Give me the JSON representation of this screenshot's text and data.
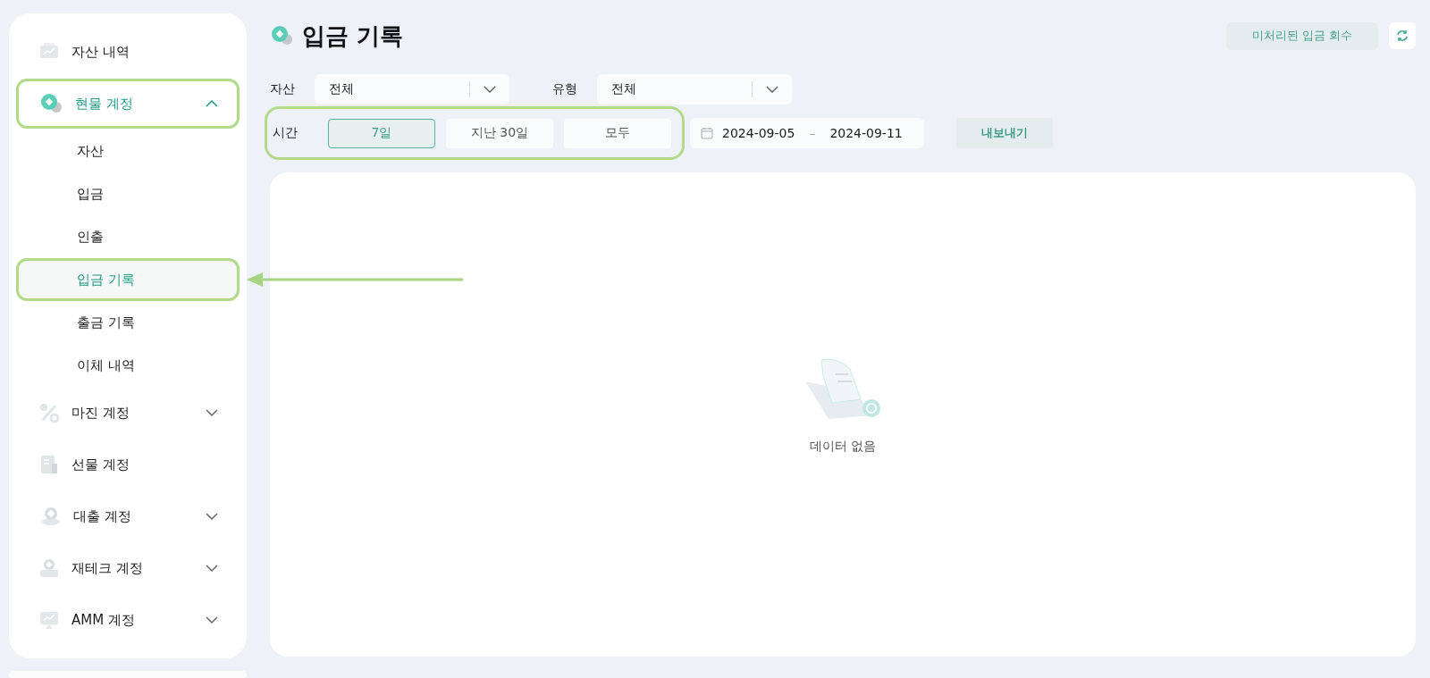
{
  "sidebar": {
    "items": [
      {
        "label": "자산 내역",
        "kind": "link",
        "selected": false,
        "highlighted": false
      },
      {
        "label": "현물 계정",
        "kind": "group",
        "selected": true,
        "expanded": true,
        "highlighted": true,
        "children": [
          {
            "label": "자산",
            "selected": false,
            "highlighted": false
          },
          {
            "label": "입금",
            "selected": false,
            "highlighted": false
          },
          {
            "label": "인출",
            "selected": false,
            "highlighted": false
          },
          {
            "label": "입금 기록",
            "selected": true,
            "highlighted": true,
            "pointer_arrow": true
          },
          {
            "label": "출금 기록",
            "selected": false,
            "highlighted": false
          },
          {
            "label": "이체 내역",
            "selected": false,
            "highlighted": false
          }
        ]
      },
      {
        "label": "마진 계정",
        "kind": "group",
        "selected": false,
        "expanded": false,
        "highlighted": false
      },
      {
        "label": "선물 계정",
        "kind": "link",
        "selected": false,
        "highlighted": false
      },
      {
        "label": "대출 계정",
        "kind": "group",
        "selected": false,
        "expanded": false,
        "highlighted": false
      },
      {
        "label": "재테크 계정",
        "kind": "group",
        "selected": false,
        "expanded": false,
        "highlighted": false
      },
      {
        "label": "AMM 계정",
        "kind": "group",
        "selected": false,
        "expanded": false,
        "highlighted": false
      }
    ]
  },
  "header": {
    "title": "입금 기록",
    "recover_button": "미처리된 입금 회수"
  },
  "filters": {
    "asset": {
      "label": "자산",
      "value": "전체"
    },
    "type": {
      "label": "유형",
      "value": "전체"
    },
    "time": {
      "label": "시간",
      "highlighted": true,
      "options": [
        {
          "label": "7일",
          "selected": true
        },
        {
          "label": "지난 30일",
          "selected": false
        },
        {
          "label": "모두",
          "selected": false
        }
      ]
    },
    "date_range": {
      "start": "2024-09-05",
      "separator": "–",
      "end": "2024-09-11"
    },
    "export_button": "내보내기"
  },
  "empty_state": {
    "message": "데이터 없음"
  }
}
